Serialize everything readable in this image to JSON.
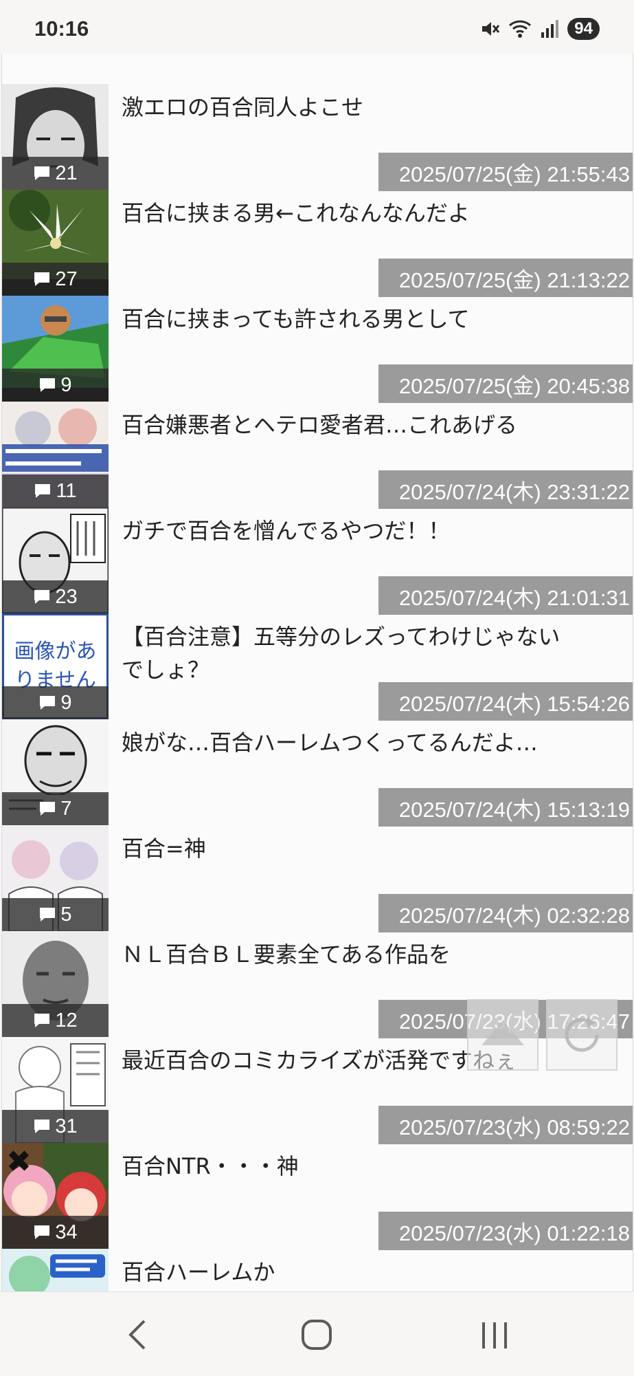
{
  "status": {
    "time": "10:16",
    "battery": "94"
  },
  "posts": [
    {
      "title": "激エロの百合同人よこせ",
      "count": "21",
      "date": "2025/07/25(金) 21:55:43",
      "thumb": "dark-face-manga"
    },
    {
      "title": "百合に挟まる男←これなんなんだよ",
      "count": "27",
      "date": "2025/07/25(金) 21:13:22",
      "thumb": "lily-flower"
    },
    {
      "title": "百合に挟まっても許される男として",
      "count": "9",
      "date": "2025/07/25(金) 20:45:38",
      "thumb": "green-robot"
    },
    {
      "title": "百合嫌悪者とヘテロ愛者君…これあげる",
      "count": "11",
      "date": "2025/07/24(木) 23:31:22",
      "thumb": "game-cover"
    },
    {
      "title": "ガチで百合を憎んでるやつだ！！",
      "count": "23",
      "date": "2025/07/24(木) 21:01:31",
      "thumb": "manga-panel"
    },
    {
      "title": "【百合注意】五等分のレズってわけじゃないでしょ？",
      "count": "9",
      "date": "2025/07/24(木) 15:54:26",
      "thumb": "no-image",
      "no_image_text": "画像がありません"
    },
    {
      "title": "娘がな…百合ハーレムつくってるんだよ…",
      "count": "7",
      "date": "2025/07/24(木) 15:13:19",
      "thumb": "manga-panel-2"
    },
    {
      "title": "百合=神",
      "count": "5",
      "date": "2025/07/24(木) 02:32:28",
      "thumb": "manga-girls"
    },
    {
      "title": "ＮＬ百合ＢＬ要素全てある作品を",
      "count": "12",
      "date": "2025/07/23(水) 17:26:47",
      "thumb": "bald-man"
    },
    {
      "title": "最近百合のコミカライズが活発ですねぇ",
      "count": "31",
      "date": "2025/07/23(水) 08:59:22",
      "thumb": "manga-sketch"
    },
    {
      "title": "百合NTR・・・神",
      "count": "34",
      "date": "2025/07/23(水) 01:22:18",
      "thumb": "anime-girls"
    },
    {
      "title": "百合ハーレムか",
      "count": "",
      "date": "",
      "thumb": "light-novel-cover"
    }
  ],
  "floating": {
    "scroll_top_icon": "arrow-up-icon",
    "reload_icon": "reload-icon"
  },
  "nav": {
    "back_icon": "back-icon",
    "home_icon": "home-icon",
    "recents_icon": "recents-icon"
  }
}
